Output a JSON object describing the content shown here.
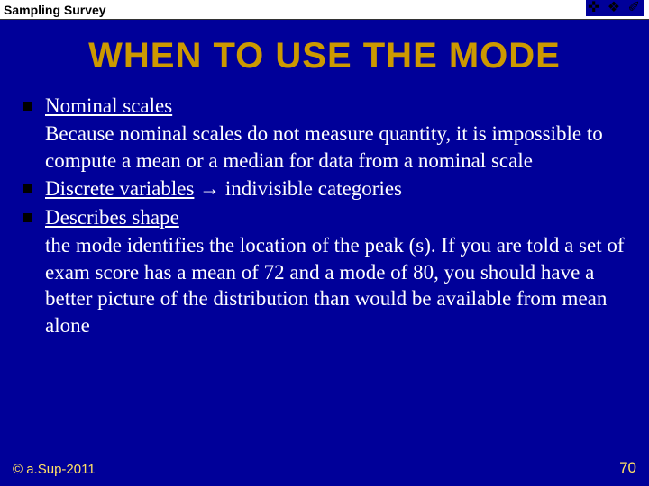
{
  "header": {
    "label": "Sampling Survey"
  },
  "title": "WHEN TO USE THE MODE",
  "bullets": [
    {
      "heading": "Nominal scales",
      "body": "Because nominal scales do not measure quantity, it is impossible to compute a mean or a median for data from a nominal scale"
    },
    {
      "heading": "Discrete variables",
      "tail": " indivisible categories",
      "arrow": "→"
    },
    {
      "heading": "Describes shape",
      "body": "the mode identifies the location of the peak (s).  If you are told a set of exam score has a mean of 72 and a mode of 80, you should have a better picture of the distribution than would be available from mean alone"
    }
  ],
  "footer": {
    "copyright": "© a.Sup-2011",
    "page": "70"
  },
  "icons": "✜ ❖ ✐"
}
